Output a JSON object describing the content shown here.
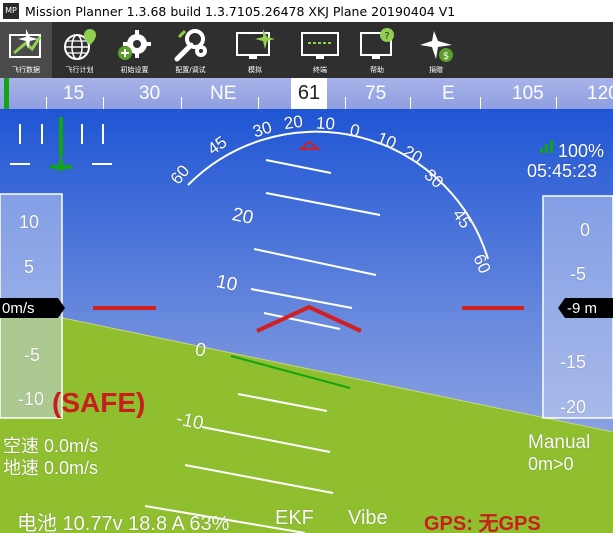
{
  "window": {
    "title": "Mission Planner 1.3.68 build 1.3.7105.26478 XKJ Plane 20190404 V1",
    "logo_text": "MP"
  },
  "toolbar": {
    "items": [
      {
        "label": "飞行数据",
        "icon": "plane-data-icon"
      },
      {
        "label": "飞行计划",
        "icon": "globe-plan-icon"
      },
      {
        "label": "初始设置",
        "icon": "gear-setup-icon"
      },
      {
        "label": "配置/调试",
        "icon": "wrench-config-icon"
      },
      {
        "label": "模拟",
        "icon": "monitor-sim-icon"
      },
      {
        "label": "终端",
        "icon": "terminal-icon"
      },
      {
        "label": "帮助",
        "icon": "help-icon"
      },
      {
        "label": "捐赠",
        "icon": "donate-icon"
      }
    ]
  },
  "heading_tape": {
    "current": "61",
    "labels": [
      "15",
      "30",
      "NE",
      "75",
      "E",
      "105",
      "120"
    ]
  },
  "hud": {
    "pitch_labels": [
      "20",
      "10",
      "0",
      "-10"
    ],
    "roll_scale_labels": [
      "60",
      "45",
      "30",
      "20",
      "10",
      "0",
      "10",
      "20",
      "30",
      "45",
      "60"
    ],
    "battery_percent": "100%",
    "clock": "05:45:23",
    "speed_tape": {
      "current": "0m/s",
      "labels": [
        "10",
        "5",
        "-5",
        "-10"
      ]
    },
    "alt_tape": {
      "current": "-9 m",
      "labels": [
        "0",
        "-5",
        "-15",
        "-20"
      ]
    },
    "safety": "(SAFE)",
    "airspeed": "空速 0.0m/s",
    "groundspeed": "地速 0.0m/s",
    "mode": "Manual",
    "distance": "0m>0",
    "battery_line": "电池 10.77v 18.8 A 63%",
    "ekf": "EKF",
    "vibe": "Vibe",
    "gps": "GPS: 无GPS"
  },
  "colors": {
    "sky_top": "#1f55d4",
    "ground": "#8fbf2e",
    "alert_red": "#cc1f1f",
    "accent_green": "#11a611"
  }
}
